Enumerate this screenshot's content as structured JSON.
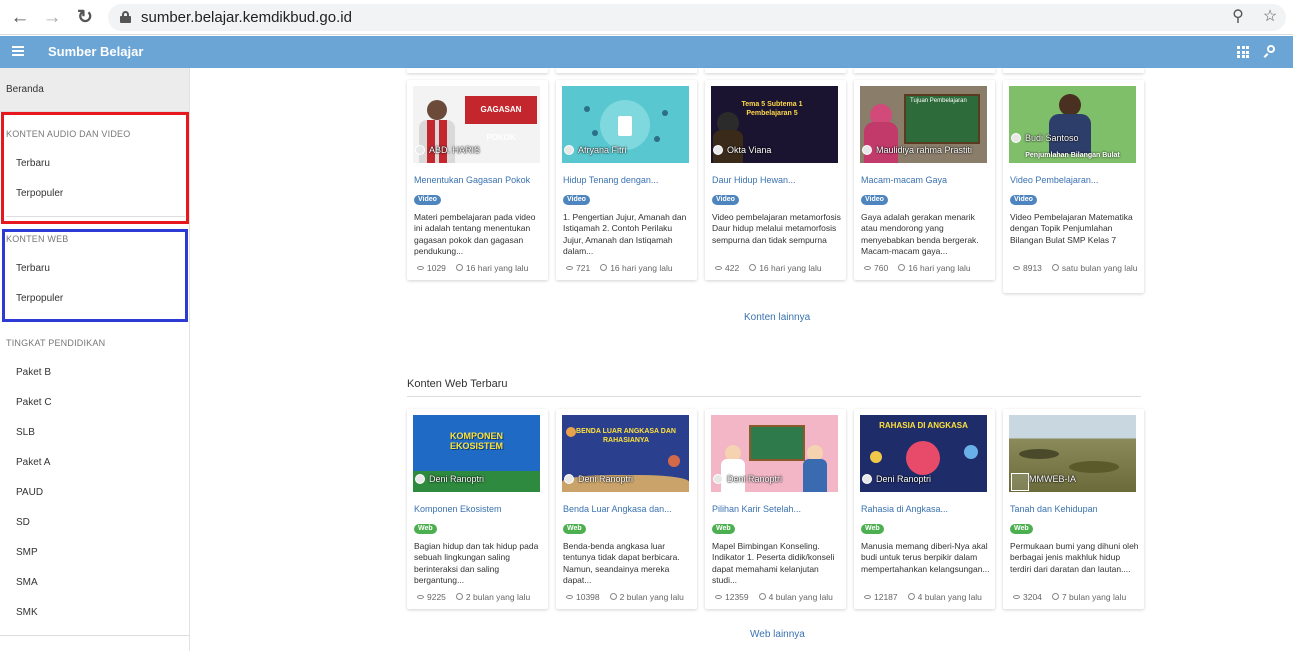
{
  "browser": {
    "url": "sumber.belajar.kemdikbud.go.id",
    "back_icon": "back-arrow-icon",
    "forward_icon": "forward-arrow-icon",
    "reload_icon": "reload-icon"
  },
  "appbar": {
    "title": "Sumber Belajar",
    "color": "#6aa5d6"
  },
  "sidebar": {
    "home": "Beranda",
    "audio_video": {
      "heading": "KONTEN AUDIO DAN VIDEO",
      "items": [
        "Terbaru",
        "Terpopuler"
      ]
    },
    "web": {
      "heading": "KONTEN WEB",
      "items": [
        "Terbaru",
        "Terpopuler"
      ]
    },
    "levels": {
      "heading": "TINGKAT PENDIDIKAN",
      "items": [
        "Paket B",
        "Paket C",
        "SLB",
        "Paket A",
        "PAUD",
        "SD",
        "SMP",
        "SMA",
        "SMK"
      ]
    },
    "highlight_colors": {
      "red": "#e6181e",
      "blue": "#2b3bd4"
    }
  },
  "video_cards": [
    {
      "author": "ABD. HARIS",
      "thumb_text": "GAGASAN POKOK",
      "title": "Menentukan Gagasan Pokok",
      "badge": "Video",
      "desc": "Materi pembelajaran pada video ini adalah tentang menentukan gagasan pokok dan gagasan pendukung...",
      "views": "1029",
      "time": "16 hari yang lalu"
    },
    {
      "author": "Afryana Fitri",
      "thumb_text": "",
      "title": "Hidup Tenang dengan...",
      "badge": "Video",
      "desc": "1. Pengertian Jujur, Amanah dan Istiqamah 2. Contoh Perilaku Jujur, Amanah dan Istiqamah dalam...",
      "views": "721",
      "time": "16 hari yang lalu"
    },
    {
      "author": "Okta Viana",
      "thumb_text": "Tema 5 Subtema 1 Pembelajaran 5",
      "title": "Daur Hidup Hewan...",
      "badge": "Video",
      "desc": "Video pembelajaran metamorfosis Daur hidup melalui metamorfosis sempurna dan tidak sempurna",
      "views": "422",
      "time": "16 hari yang lalu"
    },
    {
      "author": "Maulidiya rahma Prastiti",
      "thumb_text": "Tujuan Pembelajaran",
      "title": "Macam-macam Gaya",
      "badge": "Video",
      "desc": "Gaya adalah gerakan menarik atau mendorong yang menyebabkan benda bergerak. Macam-macam gaya...",
      "views": "760",
      "time": "16 hari yang lalu"
    },
    {
      "author": "Budi Santoso",
      "thumb_text": "Penjumlahan Bilangan Bulat",
      "title": "Video Pembelajaran...",
      "badge": "Video",
      "desc": "Video Pembelajaran Matematika dengan Topik Penjumlahan Bilangan Bulat SMP Kelas 7",
      "views": "8913",
      "time": "satu bulan yang lalu"
    }
  ],
  "video_more": "Konten lainnya",
  "web_section_title": "Konten Web Terbaru",
  "web_cards": [
    {
      "author": "Deni Ranoptri",
      "thumb_text": "KOMPONEN EKOSISTEM",
      "title": "Komponen Ekosistem",
      "badge": "Web",
      "desc": "Bagian hidup dan tak hidup pada sebuah lingkungan saling berinteraksi dan saling bergantung...",
      "views": "9225",
      "time": "2 bulan yang lalu"
    },
    {
      "author": "Deni Ranoptri",
      "thumb_text": "BENDA LUAR ANGKASA DAN RAHASIANYA",
      "title": "Benda Luar Angkasa dan...",
      "badge": "Web",
      "desc": "Benda-benda angkasa luar tentunya tidak dapat berbicara. Namun, seandainya mereka dapat...",
      "views": "10398",
      "time": "2 bulan yang lalu"
    },
    {
      "author": "Deni Ranoptri",
      "thumb_text": "",
      "title": "Pilihan Karir Setelah...",
      "badge": "Web",
      "desc": "Mapel Bimbingan Konseling. Indikator 1. Peserta didik/konseli dapat memahami kelanjutan studi...",
      "views": "12359",
      "time": "4 bulan yang lalu"
    },
    {
      "author": "Deni Ranoptri",
      "thumb_text": "RAHASIA DI ANGKASA",
      "title": "Rahasia di Angkasa...",
      "badge": "Web",
      "desc": "Manusia memang diberi-Nya akal budi untuk terus berpikir dalam mempertahankan kelangsungan...",
      "views": "12187",
      "time": "4 bulan yang lalu"
    },
    {
      "author": "MMWEB-IA",
      "thumb_text": "",
      "title": "Tanah dan Kehidupan",
      "badge": "Web",
      "desc": "Permukaan bumi yang dihuni oleh berbagai jenis makhluk hidup terdiri dari daratan dan lautan....",
      "views": "3204",
      "time": "7 bulan yang lalu"
    }
  ],
  "web_more": "Web lainnya"
}
